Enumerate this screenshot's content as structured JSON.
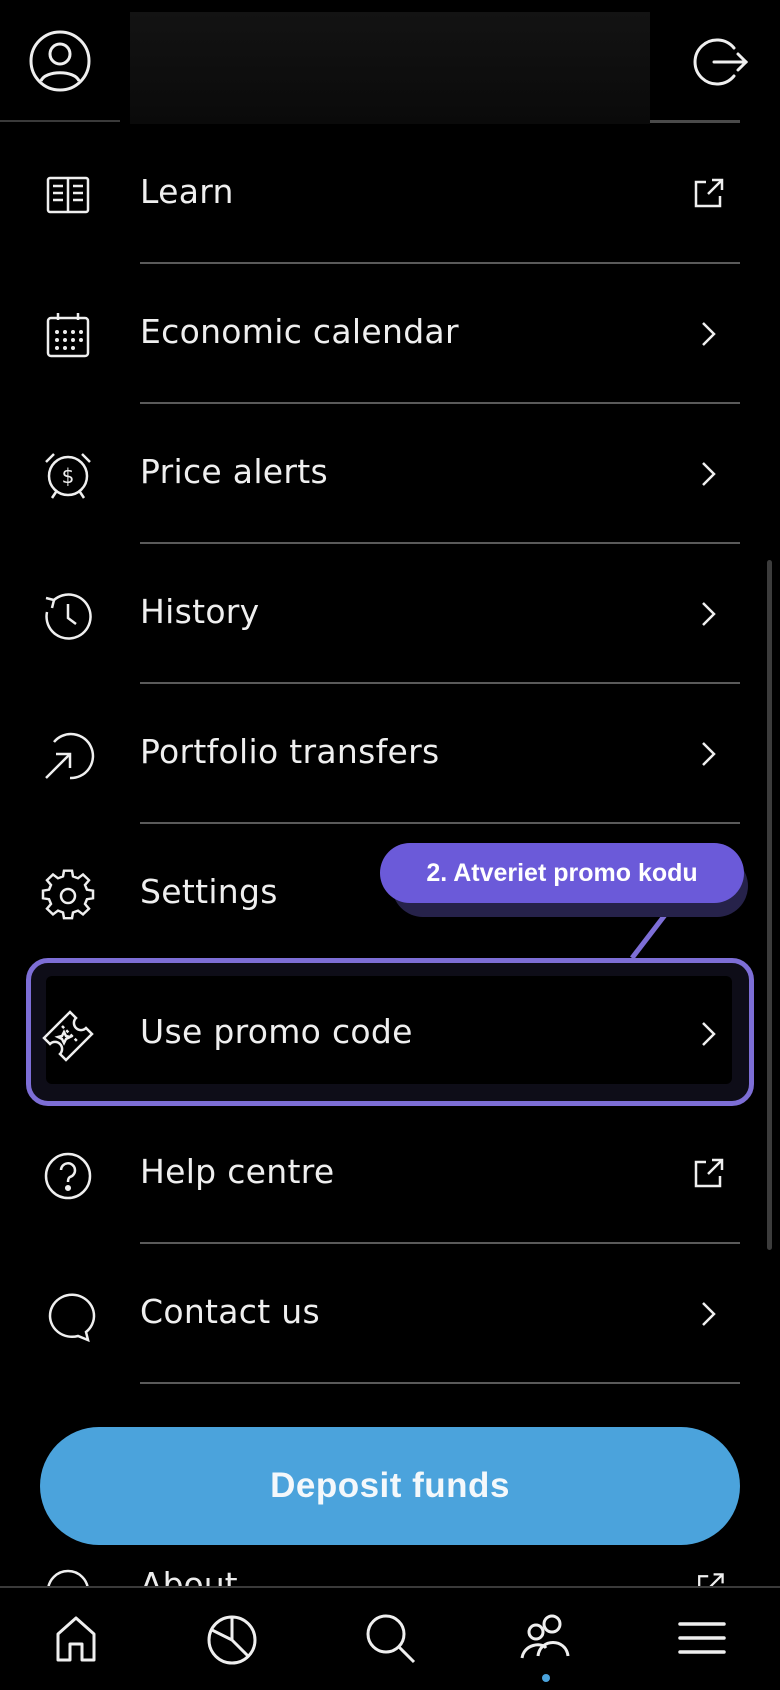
{
  "topbar": {
    "profile_icon": "user-circle-icon",
    "logout_icon": "logout-icon"
  },
  "menu": {
    "items": [
      {
        "label": "Learn",
        "icon": "book-icon",
        "trail": "external-link-icon"
      },
      {
        "label": "Economic calendar",
        "icon": "calendar-icon",
        "trail": "chevron-right-icon"
      },
      {
        "label": "Price alerts",
        "icon": "alarm-dollar-icon",
        "trail": "chevron-right-icon"
      },
      {
        "label": "History",
        "icon": "history-icon",
        "trail": "chevron-right-icon"
      },
      {
        "label": "Portfolio transfers",
        "icon": "transfer-icon",
        "trail": "chevron-right-icon"
      },
      {
        "label": "Settings",
        "icon": "gear-icon",
        "trail": "chevron-right-icon"
      },
      {
        "label": "Use promo code",
        "icon": "ticket-icon",
        "trail": "chevron-right-icon"
      },
      {
        "label": "Help centre",
        "icon": "question-icon",
        "trail": "external-link-icon"
      },
      {
        "label": "Contact us",
        "icon": "chat-bubble-icon",
        "trail": "chevron-right-icon"
      }
    ]
  },
  "tooltip": {
    "text": "2. Atveriet promo kodu",
    "color": "#6b5ad9"
  },
  "deposit": {
    "label": "Deposit funds",
    "color": "#4ba3dc"
  },
  "partial_item": {
    "label": "About"
  },
  "bottom_nav": {
    "items": [
      "home-icon",
      "portfolio-pie-icon",
      "search-icon",
      "community-icon",
      "menu-icon"
    ],
    "active": "community-icon"
  }
}
